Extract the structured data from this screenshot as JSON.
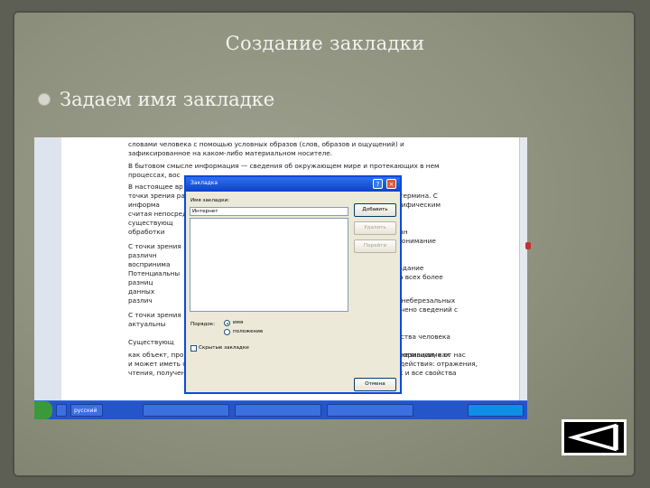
{
  "slide": {
    "title": "Создание закладки",
    "bullet": "Задаем имя закладке"
  },
  "document": {
    "lines_left": [
      "словами человека с помощью условных образов (слов, образов и ощущений) и",
      "зафиксированное на каком-либо материальном носителе.",
      "В бытовом смысле информация — сведения об окружающем мире и протекающих в нем",
      "процессах, вос",
      "В настоящее вр",
      "точки зрения ра",
      "информа",
      "считая непосред",
      "существующ",
      "обработки",
      "С точки зрения",
      "различн",
      "воспринима",
      "Потенциальны",
      "разниц",
      "данных",
      "различ",
      "С точки зрения",
      "актуальны",
      "Существующ",
      "как объект, процесс, свойство материальной мирa. Информация существует независимо от нас",
      "и может иметь отражение в нашем восприятии только как результат взаимодействия: отражения,",
      "чтения, получения в виде сигнала, стимула. Информация нематериальна, как и все свойства"
    ],
    "lines_right": [
      "азного термина. С",
      "им специфическим",
      "ии стоган",
      "ет его понимание",
      "неоправдание",
      "ря да на всех более",
      "ет",
      "стоит в неберезальных",
      "но получено сведений с",
      "ых свойства человека",
      "ных информации, как"
    ]
  },
  "dialog": {
    "title": "Закладка",
    "help_glyph": "?",
    "close_glyph": "×",
    "name_label": "Имя закладки:",
    "name_value": "Интернет",
    "add_button": "Добавить",
    "delete_button": "Удалить",
    "goto_button": "Перейти",
    "sort_label": "Порядок:",
    "sort_by_name": "имя",
    "sort_by_position": "положение",
    "hidden_checkbox": "Скрытые закладки",
    "cancel_button": "Отмена"
  },
  "taskbar": {
    "language": "русский"
  },
  "nav": {
    "back_icon": "back-triangle-icon"
  }
}
